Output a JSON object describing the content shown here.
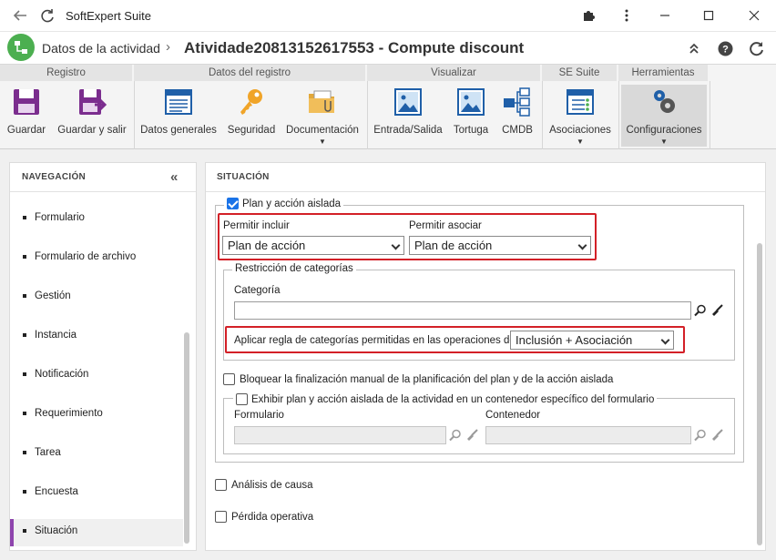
{
  "window": {
    "app_title": "SoftExpert Suite"
  },
  "header": {
    "crumb_parent": "Datos de la actividad",
    "crumb_sep": "›",
    "crumb_current": "Atividade20813152617553 - Compute discount"
  },
  "ribbon": {
    "groups": [
      "Registro",
      "Datos del registro",
      "Visualizar",
      "SE Suite",
      "Herramientas"
    ],
    "buttons": {
      "guardar": "Guardar",
      "guardar_salir": "Guardar y salir",
      "datos_generales": "Datos generales",
      "seguridad": "Seguridad",
      "documentacion": "Documentación",
      "entrada_salida": "Entrada/Salida",
      "tortuga": "Tortuga",
      "cmdb": "CMDB",
      "asociaciones": "Asociaciones",
      "configuraciones": "Configuraciones"
    }
  },
  "nav": {
    "title": "NAVEGACIÓN",
    "items": [
      "Formulario",
      "Formulario de archivo",
      "Gestión",
      "Instancia",
      "Notificación",
      "Requerimiento",
      "Tarea",
      "Encuesta",
      "Situación"
    ],
    "active_index": 8
  },
  "main": {
    "title": "SITUACIÓN",
    "plan_section": {
      "legend": "Plan y acción aislada",
      "checked": true,
      "permitir_incluir_label": "Permitir incluir",
      "permitir_incluir_value": "Plan de acción",
      "permitir_asociar_label": "Permitir asociar",
      "permitir_asociar_value": "Plan de acción",
      "restriccion": {
        "legend": "Restricción de categorías",
        "categoria_label": "Categoría",
        "categoria_value": "",
        "regla_label": "Aplicar regla de categorías permitidas en las operaciones de:",
        "regla_value": "Inclusión + Asociación"
      },
      "bloquear_label": "Bloquear la finalización manual de la planificación del plan y de la acción aislada",
      "exhibir": {
        "legend": "Exhibir plan y acción aislada de la actividad en un contenedor específico del formulario",
        "formulario_label": "Formulario",
        "contenedor_label": "Contenedor"
      }
    },
    "analisis_label": "Análisis de causa",
    "perdida_label": "Pérdida operativa"
  },
  "colors": {
    "accent": "#1a73e8",
    "highlight": "#d32027",
    "nav_active": "#8e44ad",
    "logo": "#4caf50"
  }
}
